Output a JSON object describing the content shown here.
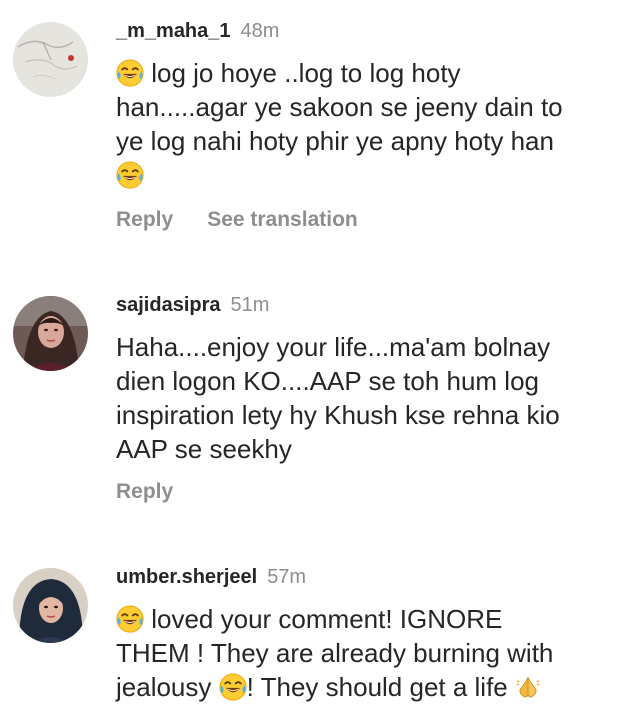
{
  "comments": [
    {
      "username": "_m_maha_1",
      "time": "48m",
      "text_lines": [
        "log jo hoye ..log to log hoty",
        "han.....agar ye sakoon se jeeny dain to",
        "ye log nahi hoty phir ye apny hoty han"
      ],
      "avatar_icon": "sketch-avatar-icon",
      "reply_label": "Reply",
      "translate_label": "See translation"
    },
    {
      "username": "sajidasipra",
      "time": "51m",
      "text_lines": [
        "Haha....enjoy your life...ma'am bolnay",
        "dien logon KO....AAP se toh hum log",
        "inspiration lety hy Khush kse rehna kio",
        "AAP se seekhy"
      ],
      "avatar_icon": "profile-photo-icon",
      "reply_label": "Reply"
    },
    {
      "username": "umber.sherjeel",
      "time": "57m",
      "text_lines": [
        "loved your comment! IGNORE",
        "THEM ! They are already burning with",
        "jealousy",
        "! They should get a life"
      ],
      "avatar_icon": "hijab-avatar-icon"
    }
  ],
  "emoji": {
    "laughing": "face-with-tears-of-joy-icon",
    "pray": "folded-hands-icon"
  }
}
